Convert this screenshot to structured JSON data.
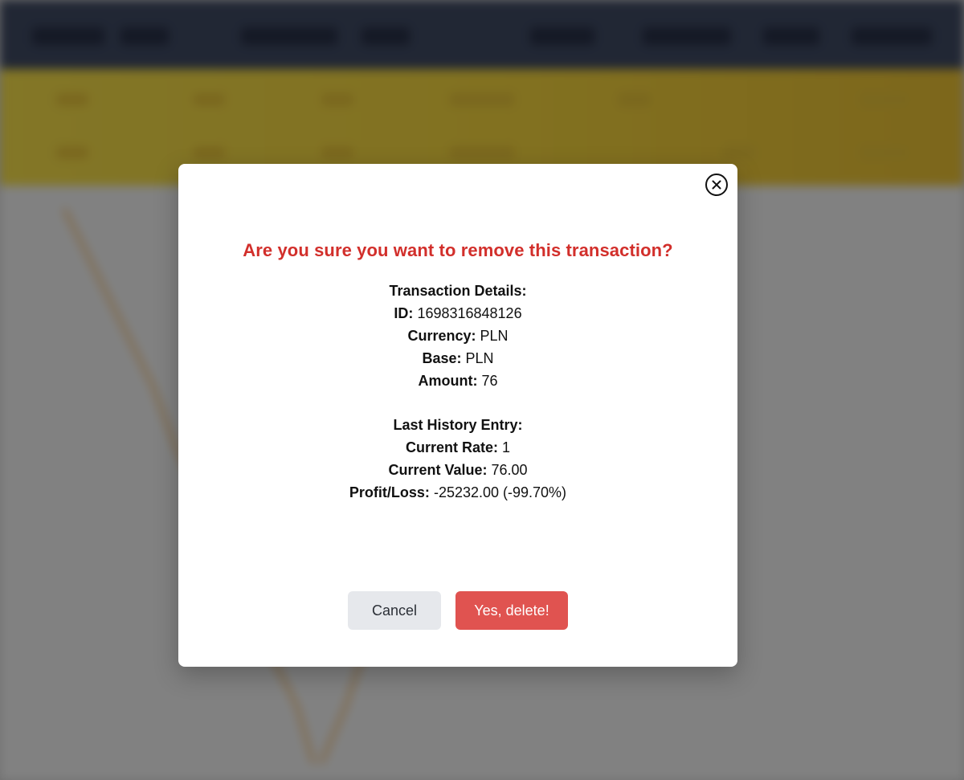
{
  "modal": {
    "title": "Are you sure you want to remove this transaction?",
    "transaction_heading": "Transaction Details:",
    "fields": {
      "id_label": "ID:",
      "id_value": "1698316848126",
      "currency_label": "Currency:",
      "currency_value": "PLN",
      "base_label": "Base:",
      "base_value": "PLN",
      "amount_label": "Amount:",
      "amount_value": "76"
    },
    "history_heading": "Last History Entry:",
    "history": {
      "rate_label": "Current Rate:",
      "rate_value": "1",
      "value_label": "Current Value:",
      "value_value": "76.00",
      "pl_label": "Profit/Loss:",
      "pl_value": "-25232.00 (-99.70%)"
    },
    "cancel_label": "Cancel",
    "delete_label": "Yes, delete!",
    "close_icon": "close-icon"
  },
  "colors": {
    "title": "#d22f2b",
    "delete_button": "#e05350",
    "cancel_button": "#e6e8ec",
    "header_bar": "#f7e04a",
    "top_nav": "#3f4a63"
  }
}
